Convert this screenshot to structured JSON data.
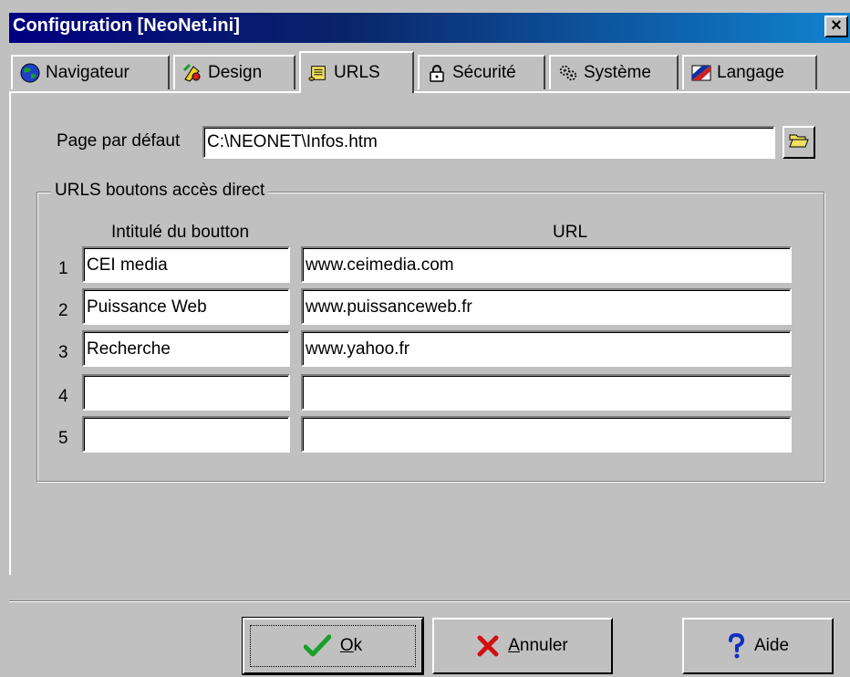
{
  "window": {
    "title": "Configuration [NeoNet.ini]",
    "close_label": "×"
  },
  "tabs": [
    {
      "label": "Navigateur",
      "icon": "globe-icon"
    },
    {
      "label": "Design",
      "icon": "paint-icon"
    },
    {
      "label": "URLS",
      "icon": "scroll-icon",
      "active": true
    },
    {
      "label": "Sécurité",
      "icon": "lock-icon"
    },
    {
      "label": "Système",
      "icon": "system-icon"
    },
    {
      "label": "Langage",
      "icon": "flag-icon"
    }
  ],
  "default_page": {
    "label": "Page par défaut",
    "value": "C:\\NEONET\\Infos.htm"
  },
  "group": {
    "title": "URLS boutons accès direct",
    "col_label": "Intitulé du boutton",
    "col_url": "URL",
    "rows": [
      {
        "num": "1",
        "label": "CEI media",
        "url": "www.ceimedia.com"
      },
      {
        "num": "2",
        "label": "Puissance Web",
        "url": "www.puissanceweb.fr"
      },
      {
        "num": "3",
        "label": "Recherche",
        "url": "www.yahoo.fr"
      },
      {
        "num": "4",
        "label": "",
        "url": ""
      },
      {
        "num": "5",
        "label": "",
        "url": ""
      }
    ]
  },
  "buttons": {
    "ok": {
      "mnemonic": "O",
      "rest": "k"
    },
    "cancel": {
      "mnemonic": "A",
      "rest": "nnuler"
    },
    "help": "Aide"
  }
}
